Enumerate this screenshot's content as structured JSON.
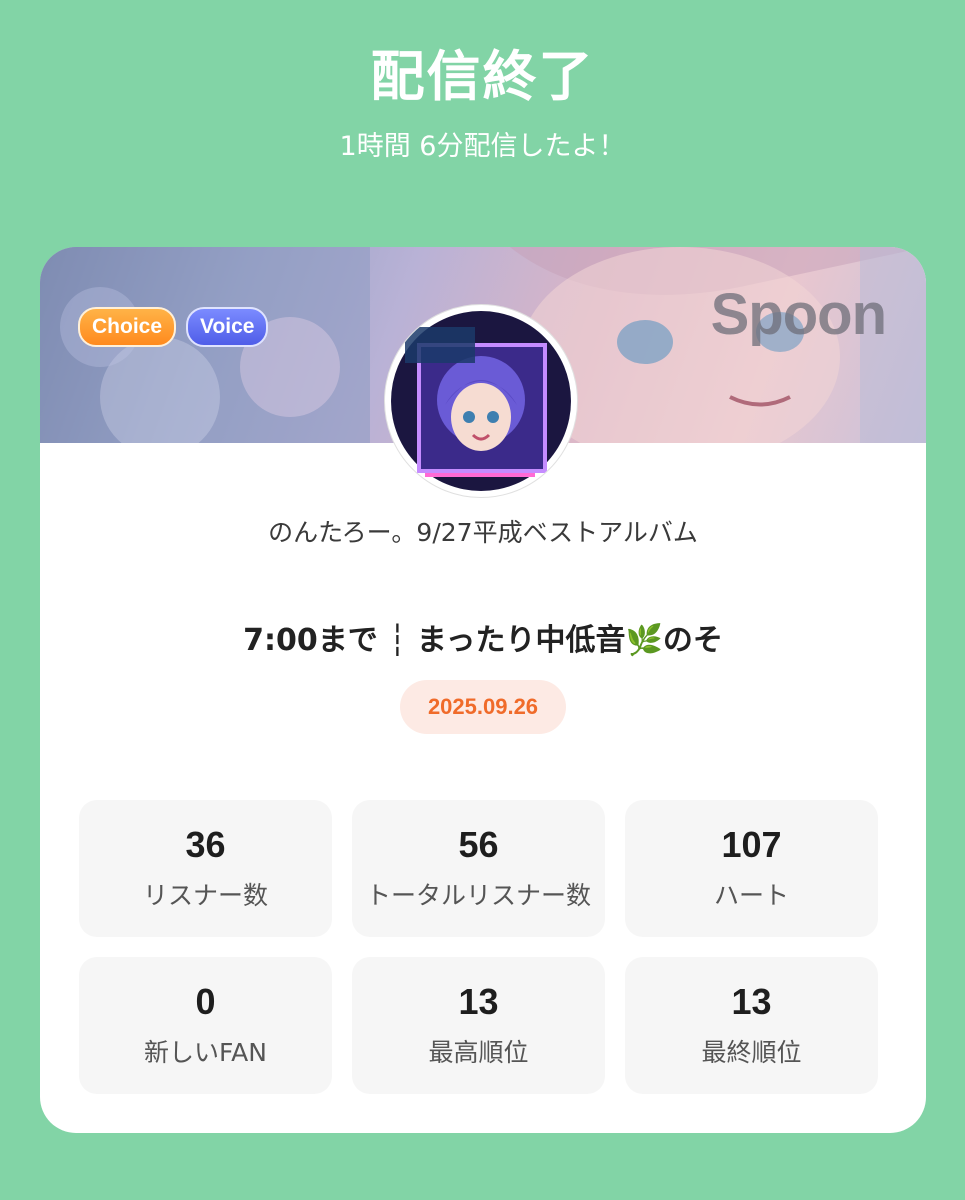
{
  "header": {
    "title": "配信終了",
    "subtitle": "1時間 6分配信したよ！"
  },
  "banner": {
    "badges": [
      "Choice",
      "Voice"
    ],
    "brand": "Spoon",
    "colors": {
      "choice": "#ff8a1e",
      "voice": "#4f5de8"
    }
  },
  "streamer": {
    "name": "のんたろー。9/27平成ベストアルバム"
  },
  "live": {
    "title": "7:00まで ┆ まったり中低音🌿のそ",
    "date": "2025.09.26"
  },
  "stats": [
    {
      "value": "36",
      "label": "リスナー数"
    },
    {
      "value": "56",
      "label": "トータルリスナー数"
    },
    {
      "value": "107",
      "label": "ハート"
    },
    {
      "value": "0",
      "label": "新しいFAN"
    },
    {
      "value": "13",
      "label": "最高順位"
    },
    {
      "value": "13",
      "label": "最終順位"
    }
  ],
  "colors": {
    "background": "#82d4a6",
    "date_text": "#f06b2a",
    "date_bg": "#fdeae4"
  }
}
